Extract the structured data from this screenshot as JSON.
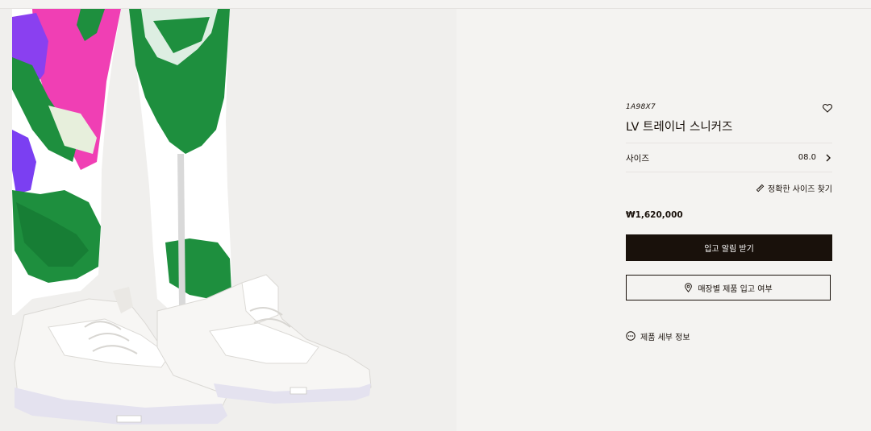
{
  "product": {
    "sku": "1A98X7",
    "title": "LV 트레이너 스니커즈",
    "size_label": "사이즈",
    "size_value": "08.0",
    "fit_link": "정확한 사이즈 찾기",
    "price": "₩1,620,000",
    "notify_button": "입고 알림 받기",
    "store_stock_button": "매장별 제품 입고 여부",
    "details_link": "제품 세부 정보",
    "shoe_logo_marks": "✦●✦"
  },
  "icons": {
    "wishlist": "heart-icon",
    "size_chevron": "chevron-right-icon",
    "fit": "ruler-icon",
    "store": "location-pin-icon",
    "details": "more-dots-icon"
  },
  "colors": {
    "background": "#f4f3f1",
    "primary_button": "#19110b",
    "text": "#19110b",
    "pant_green": "#1e8f3e",
    "pant_magenta": "#f03fb4",
    "pant_purple": "#7b3ff2"
  }
}
